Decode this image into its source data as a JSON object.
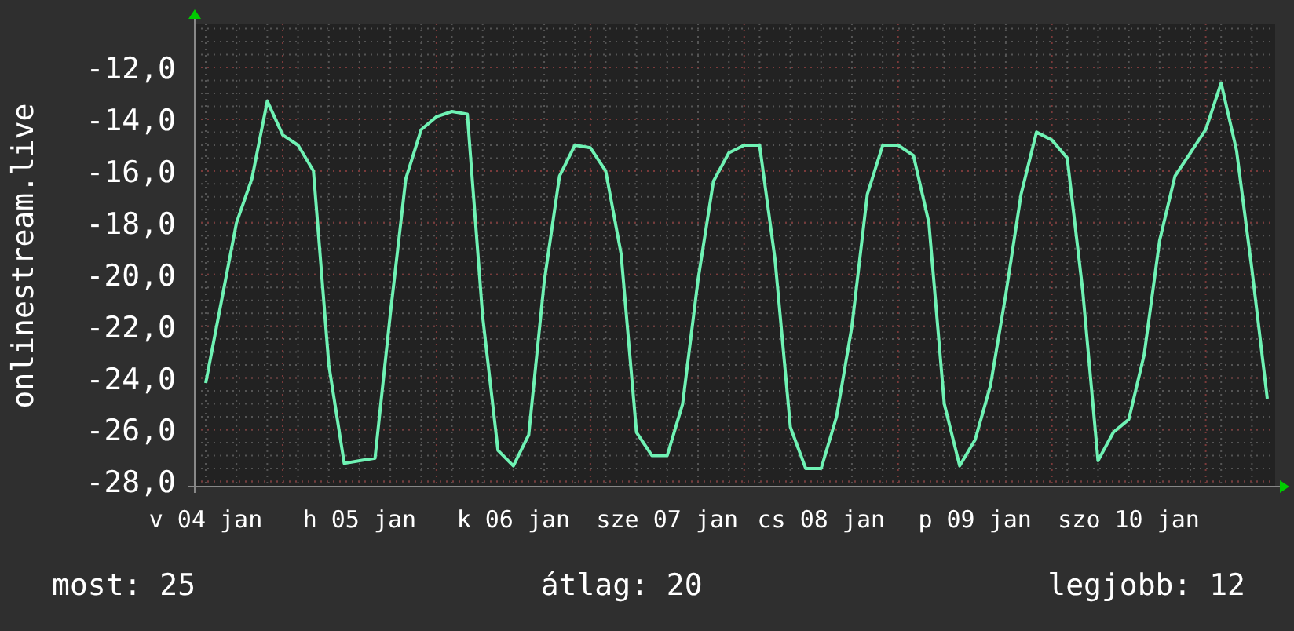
{
  "graph": {
    "chart_data": {
      "type": "line",
      "ylabel": "onlinestream.live",
      "grid": true,
      "ylim": [
        -28.2,
        -10.3
      ],
      "yticks": [
        {
          "value": -12,
          "label": "-12,0"
        },
        {
          "value": -14,
          "label": "-14,0"
        },
        {
          "value": -16,
          "label": "-16,0"
        },
        {
          "value": -18,
          "label": "-18,0"
        },
        {
          "value": -20,
          "label": "-20,0"
        },
        {
          "value": -22,
          "label": "-22,0"
        },
        {
          "value": -24,
          "label": "-24,0"
        },
        {
          "value": -26,
          "label": "-26,0"
        },
        {
          "value": -28,
          "label": "-28,0"
        }
      ],
      "categories": [
        "v 04 jan",
        null,
        null,
        null,
        null,
        null,
        null,
        null,
        null,
        null,
        "h 05 jan",
        null,
        null,
        null,
        null,
        null,
        null,
        null,
        null,
        null,
        "k 06 jan",
        null,
        null,
        null,
        null,
        null,
        null,
        null,
        null,
        null,
        "sze 07 jan",
        null,
        null,
        null,
        null,
        null,
        null,
        null,
        null,
        null,
        "cs 08 jan",
        null,
        null,
        null,
        null,
        null,
        null,
        null,
        null,
        null,
        "p 09 jan",
        null,
        null,
        null,
        null,
        null,
        null,
        null,
        null,
        null,
        "szo 10 jan",
        null,
        null,
        null,
        null,
        null,
        null,
        null,
        null,
        null
      ],
      "series": [
        {
          "color": "#6ff2b4",
          "values": [
            -24.2,
            -21.1,
            -18,
            -16.3,
            -13.3,
            -14.6,
            -15,
            -16,
            -23.5,
            -27.3,
            -27.2,
            -27.1,
            -21.5,
            -16.3,
            -14.4,
            -13.9,
            -13.7,
            -13.8,
            -21.6,
            -26.8,
            -27.4,
            -26.2,
            -20.3,
            -16.2,
            -15,
            -15.1,
            -16,
            -19.2,
            -26.1,
            -27,
            -27,
            -25,
            -20.2,
            -16.4,
            -15.3,
            -15,
            -15,
            -19.4,
            -25.9,
            -27.5,
            -27.5,
            -25.5,
            -22,
            -16.9,
            -15,
            -15,
            -15.4,
            -18,
            -25,
            -27.4,
            -26.4,
            -24.3,
            -20.8,
            -16.9,
            -14.5,
            -14.8,
            -15.5,
            -20.6,
            -27.2,
            -26.1,
            -25.6,
            -23.1,
            -18.7,
            -16.2,
            -15.3,
            -14.4,
            -12.6,
            -15.2,
            -19.8,
            -24.8
          ]
        }
      ]
    }
  },
  "footer": [
    "most: 25",
    "átlag: 20",
    "legjobb: 12"
  ]
}
